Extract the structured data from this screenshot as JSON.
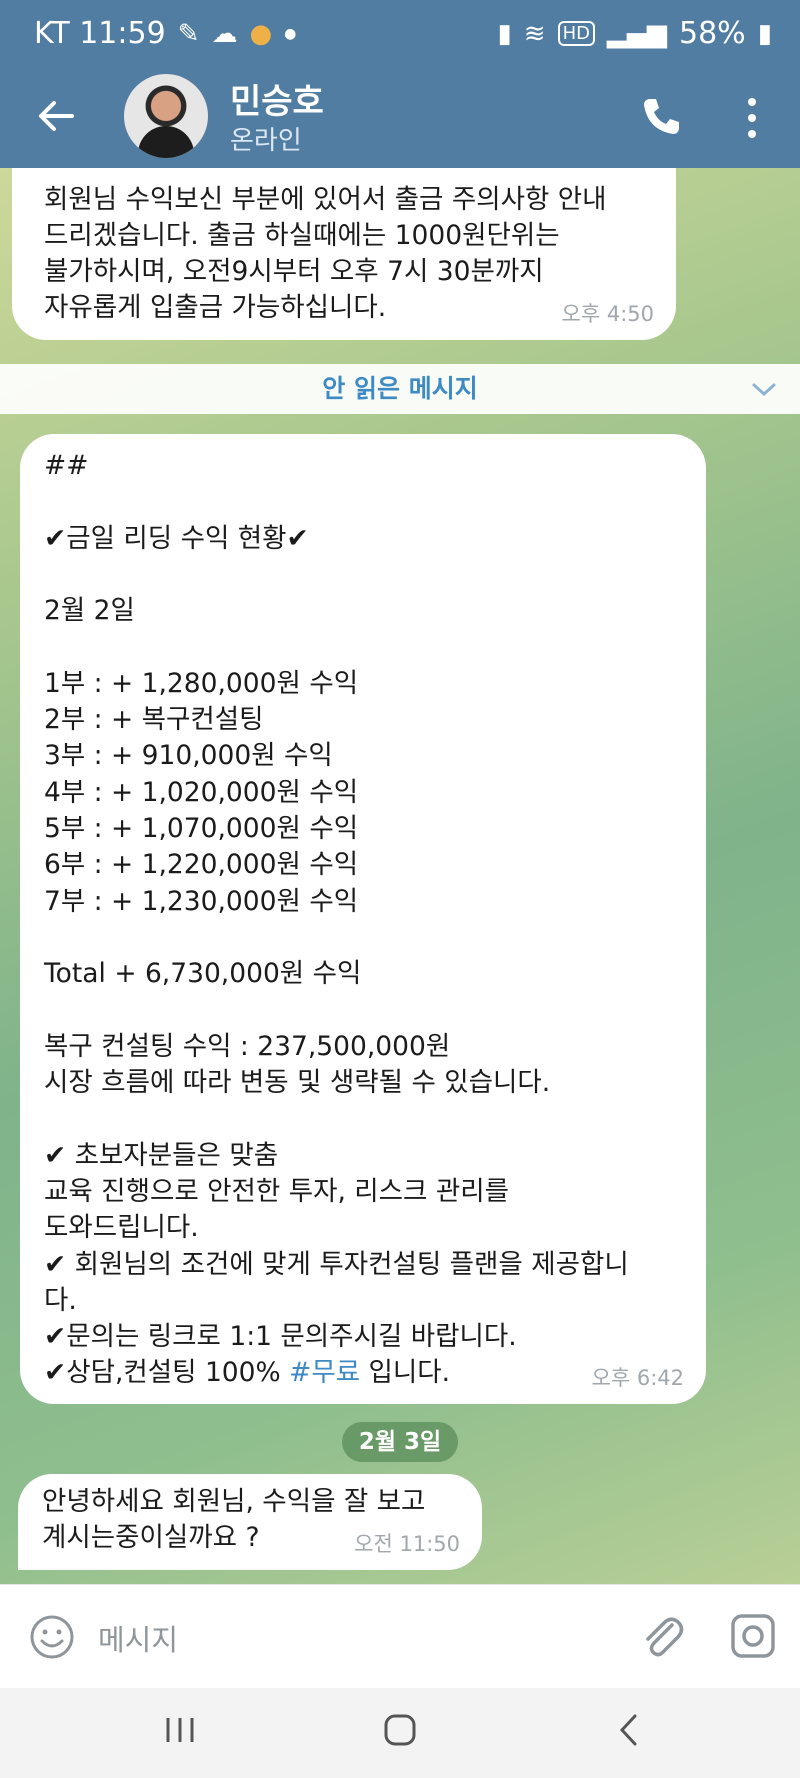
{
  "status_bar": {
    "carrier_time": "KT 11:59",
    "battery": "58%",
    "left_icons": [
      "pen-icon",
      "cloud-icon",
      "notification-icon",
      "dot-icon"
    ],
    "right_icons": [
      "battery-saver-icon",
      "wifi-icon",
      "hd-icon",
      "signal-icon",
      "battery-icon"
    ]
  },
  "header": {
    "name": "민승호",
    "status": "온라인"
  },
  "messages": [
    {
      "text": "회원님 수익보신 부분에 있어서 출금 주의사항 안내\n드리겠습니다. 출금 하실때에는 1000원단위는\n불가하시며, 오전9시부터 오후 7시 30분까지\n자유롭게 입출금 가능하십니다.",
      "time": "오후 4:50"
    },
    {
      "text": "##\n\n✔금일 리딩 수익 현황✔\n\n2월 2일\n\n1부 : + 1,280,000원 수익\n2부 : + 복구컨설팅\n3부 : + 910,000원 수익\n4부 : + 1,020,000원 수익\n5부 : + 1,070,000원 수익\n6부 : + 1,220,000원 수익\n7부 : + 1,230,000원 수익\n\nTotal + 6,730,000원 수익\n\n복구 컨설팅 수익 : 237,500,000원\n시장 흐름에 따라 변동 및 생략될 수 있습니다.\n\n✔ 초보자분들은 맞춤\n교육 진행으로 안전한 투자, 리스크 관리를\n도와드립니다.\n✔ 회원님의 조건에 맞게 투자컨설팅 플랜을 제공합니\n다.\n✔문의는 링크로 1:1 문의주시길 바랍니다.\n✔상담,컨설팅 100% ",
      "hashtag": "#무료",
      "text_tail": " 입니다.",
      "time": "오후 6:42"
    },
    {
      "text": "안녕하세요 회원님, 수익을 잘 보고\n계시는중이실까요 ?",
      "time": "오전 11:50"
    }
  ],
  "unread_banner": "안 읽은 메시지",
  "date_chip": "2월 3일",
  "input": {
    "placeholder": "메시지"
  },
  "colors": {
    "header": "#517da2",
    "accent": "#3d8ac4",
    "bubble": "#ffffff"
  }
}
